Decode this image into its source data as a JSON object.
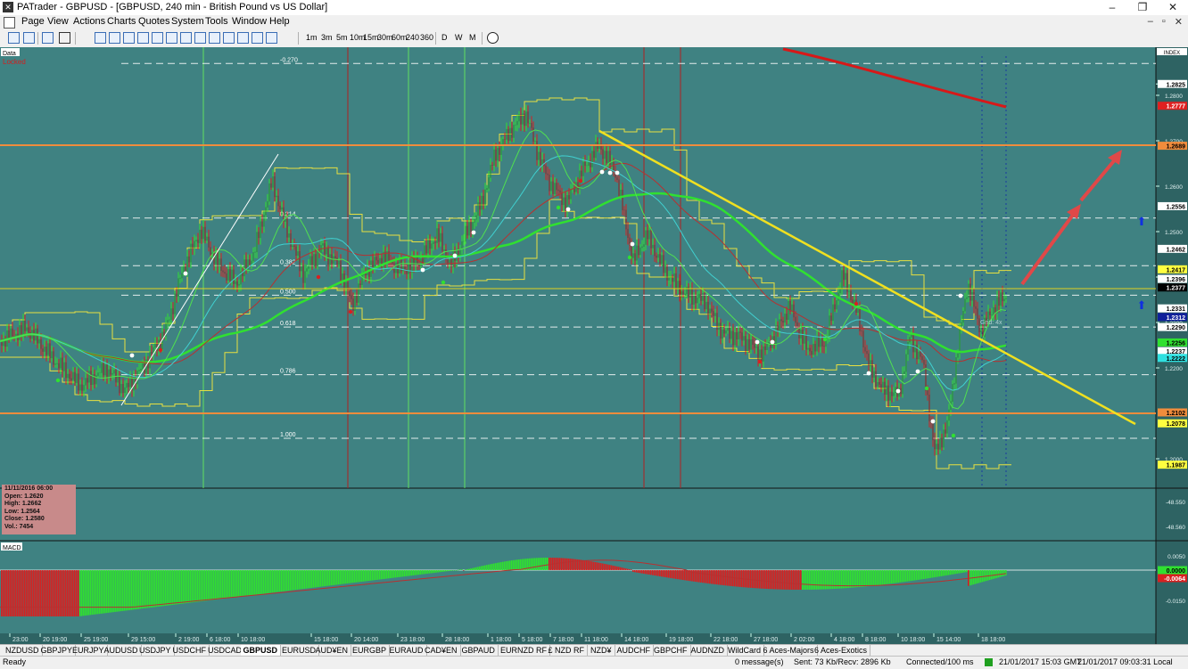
{
  "window": {
    "title": "PATrader - GBPUSD - [GBPUSD, 240 min - British Pound vs US Dollar]",
    "minimize": "–",
    "maximize": "❐",
    "close": "✕"
  },
  "menu": [
    "Page",
    "View",
    "Actions",
    "Charts",
    "Quotes",
    "System",
    "Tools",
    "Window",
    "Help"
  ],
  "timeframes": [
    "1m",
    "3m",
    "5m",
    "10m",
    "15m",
    "30m",
    "60m",
    "240",
    "360",
    "D",
    "W",
    "M"
  ],
  "chart": {
    "data_label": "Data",
    "locked_label": "Locked",
    "index_label": "INDEX",
    "macd_label": "MACD",
    "grid_label": "Grid: 4x",
    "ohlc": {
      "date": "11/11/2016 06:00",
      "open": "Open: 1.2620",
      "high": "High: 1.2662",
      "low": "Low: 1.2564",
      "close": "Close: 1.2580",
      "vol": "Vol.: 7454"
    },
    "fib_levels": [
      {
        "label": "-0.270",
        "price": 1.287
      },
      {
        "label": "0.214",
        "price": 1.253
      },
      {
        "label": "0.382",
        "price": 1.2425
      },
      {
        "label": "0.500",
        "price": 1.236
      },
      {
        "label": "0.618",
        "price": 1.229
      },
      {
        "label": "0.786",
        "price": 1.2185
      },
      {
        "label": "1.000",
        "price": 1.2045
      }
    ],
    "price_axis_ticks": [
      "1.2825",
      "1.2800",
      "1.2700",
      "1.2600",
      "1.2500",
      "1.2400",
      "1.2300",
      "1.2200",
      "1.2000"
    ],
    "price_markers": [
      {
        "label": "1.2825",
        "price": 1.2825,
        "color": "#ffffff"
      },
      {
        "label": "1.2777",
        "price": 1.2777,
        "color": "#e02020"
      },
      {
        "label": "1.2689",
        "price": 1.2689,
        "color": "#f08c3c"
      },
      {
        "label": "1.2556",
        "price": 1.2556,
        "color": "#ffffff"
      },
      {
        "label": "1.2462",
        "price": 1.2462,
        "color": "#ffffff"
      },
      {
        "label": "1.2417",
        "price": 1.2417,
        "color": "#ffff40"
      },
      {
        "label": "1.2396",
        "price": 1.2396,
        "color": "#ffffff"
      },
      {
        "label": "1.2377",
        "price": 1.2377,
        "color": "#000000"
      },
      {
        "label": "1.2331",
        "price": 1.2331,
        "color": "#ffffff"
      },
      {
        "label": "1.2312",
        "price": 1.2312,
        "color": "#10209a"
      },
      {
        "label": "1.2290",
        "price": 1.229,
        "color": "#ffffff"
      },
      {
        "label": "1.2256",
        "price": 1.2256,
        "color": "#30e030"
      },
      {
        "label": "1.2237",
        "price": 1.2237,
        "color": "#ffffff"
      },
      {
        "label": "1.2222",
        "price": 1.2222,
        "color": "#30e0e0"
      },
      {
        "label": "1.2102",
        "price": 1.2102,
        "color": "#f08c3c"
      },
      {
        "label": "1.2078",
        "price": 1.2078,
        "color": "#ffff40"
      },
      {
        "label": "1.1987",
        "price": 1.1987,
        "color": "#ffff40"
      }
    ],
    "sub_ticks": [
      "-48.550",
      "-48.560"
    ],
    "macd_ticks": [
      "0.0050",
      "-0.0150"
    ],
    "macd_markers": [
      "0.0000",
      "-0.0064"
    ],
    "time_labels": [
      "23:00",
      "20 19:00",
      "25 19:00",
      "29 15:00",
      "2 19:00",
      "6 18:00",
      "10 18:00",
      "15 18:00",
      "20 14:00",
      "23 18:00",
      "28 18:00",
      "1 18:00",
      "5 18:00",
      "7 18:00",
      "11 18:00",
      "14 18:00",
      "19 18:00",
      "22 18:00",
      "27 18:00",
      "2 02:00",
      "4 18:00",
      "8 18:00",
      "10 18:00",
      "15 14:00",
      "18 18:00"
    ]
  },
  "symbol_tabs": [
    "NZDUSD",
    "GBPJPY",
    "EURJPY",
    "AUDUSD",
    "USDJPY",
    "USDCHF",
    "USDCAD",
    "GBPUSD",
    "EURUSD",
    "AUD¥EN",
    "EURGBP",
    "EURAUD",
    "CAD¥EN",
    "GBPAUD",
    "EURNZD RF",
    "£ NZD RF",
    "NZD¥",
    "AUDCHF",
    "GBPCHF",
    "AUDNZD",
    "WildCard",
    "6 Aces-Majors",
    "6 Aces-Exotics"
  ],
  "active_tab": "GBPUSD",
  "status": {
    "ready": "Ready",
    "messages": "0 message(s)",
    "sent": "Sent: 73 Kb/Recv: 2896 Kb",
    "connected": "Connected/100 ms",
    "time": "21/01/2017 15:03 GMT",
    "local": "21/01/2017 09:03:31 Local"
  },
  "colors": {
    "chart_bg": "#3f8282",
    "axis_bg": "#2e6363",
    "price_up": "#30e030",
    "price_down": "#d82020",
    "trendline": "#f0e020",
    "support": "#f08c3c",
    "arrow": "#e04040"
  }
}
